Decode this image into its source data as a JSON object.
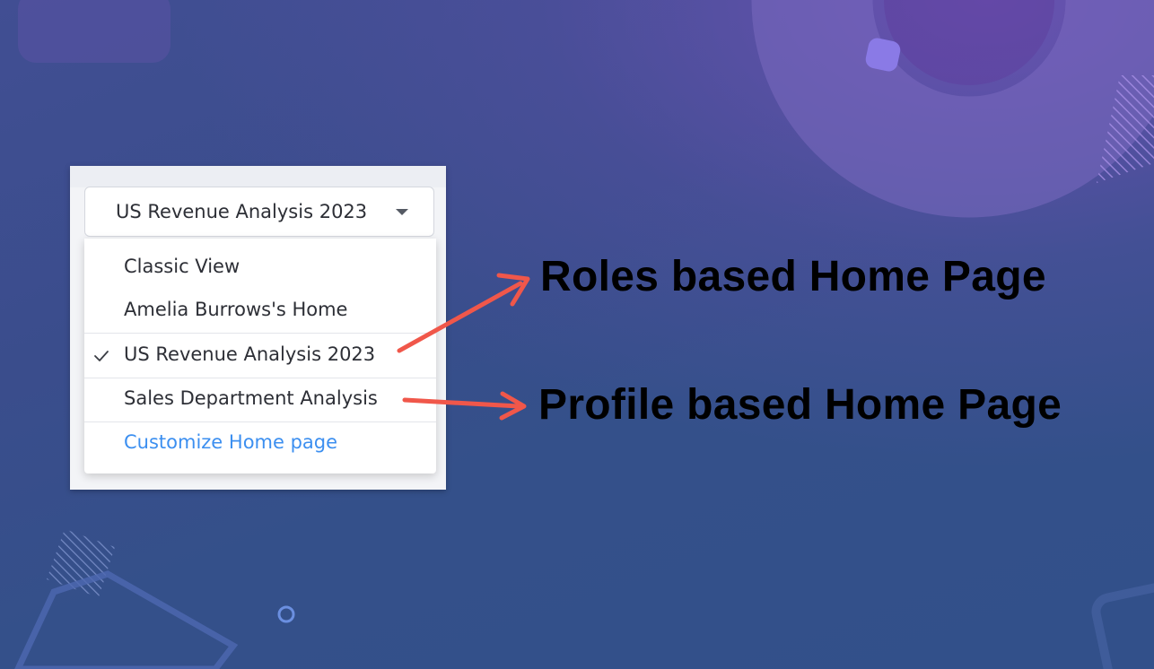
{
  "dropdown": {
    "selected_label": "US Revenue Analysis 2023",
    "caret_icon": "caret-down-icon",
    "items": [
      {
        "label": "Classic View",
        "selected": false
      },
      {
        "label": "Amelia Burrows's Home",
        "selected": false
      },
      {
        "label": "US Revenue Analysis 2023",
        "selected": true
      },
      {
        "label": "Sales Department Analysis",
        "selected": false
      }
    ],
    "customize_link": "Customize Home page"
  },
  "annotations": {
    "roles_label": "Roles based Home Page",
    "profile_label": "Profile based Home Page"
  },
  "colors": {
    "arrow": "#f0574a",
    "link": "#3c8ff0",
    "background_start": "#414e93",
    "background_end": "#32508a",
    "accent_purple": "#7a54be"
  },
  "icons": {
    "check": "check-icon",
    "arrow": "arrow-icon"
  }
}
